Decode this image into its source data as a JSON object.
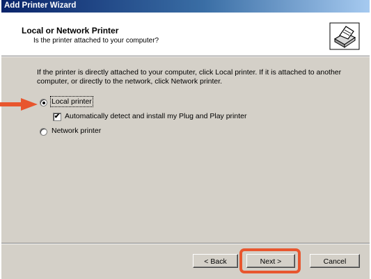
{
  "window": {
    "title": "Add Printer Wizard"
  },
  "header": {
    "title": "Local or Network Printer",
    "subtitle": "Is the printer attached to your computer?",
    "icon": "printer-icon"
  },
  "body": {
    "description": "If the printer is directly attached to your computer, click Local printer.  If it is attached to another computer, or directly to the network, click Network printer.",
    "local_printer_label": "Local printer",
    "auto_detect_label": "Automatically detect and install my Plug and Play printer",
    "network_printer_label": "Network printer",
    "selected_option": "Local printer",
    "auto_detect_checked": true
  },
  "buttons": {
    "back": "< Back",
    "next": "Next >",
    "cancel": "Cancel"
  },
  "annotations": {
    "arrow_color": "#e8562e",
    "highlight_color": "#e8562e"
  }
}
